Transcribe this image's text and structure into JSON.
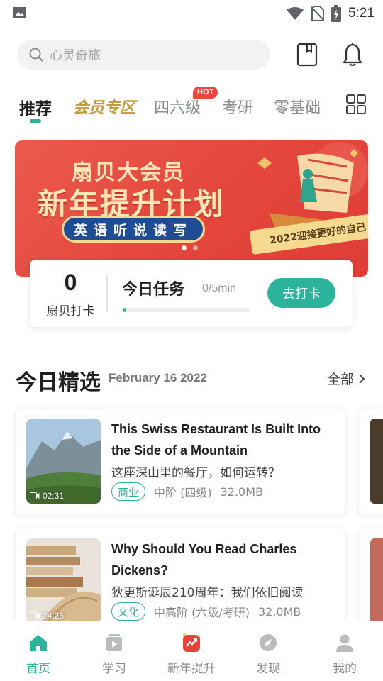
{
  "status_bar": {
    "time": "5:21"
  },
  "search": {
    "placeholder": "心灵奇旅"
  },
  "tabs": [
    {
      "label": "推荐"
    },
    {
      "label": "会员专区"
    },
    {
      "label": "四六级"
    },
    {
      "label": "考研"
    },
    {
      "label": "零基础"
    }
  ],
  "hot_badge": "HOT",
  "banner": {
    "line1": "扇贝大会员",
    "line2": "新年提升计划",
    "pill": "英语听说读写",
    "ribbon": "2022迎接更好的自己",
    "slide_count": 2,
    "active_slide": 1
  },
  "checkin": {
    "count": "0",
    "count_label": "扇贝打卡",
    "task_label": "今日任务",
    "task_progress": "0/5min",
    "progress_fraction": 0.03,
    "button": "去打卡"
  },
  "today": {
    "title": "今日精选",
    "date": "February 16 2022",
    "all_label": "全部"
  },
  "articles": [
    {
      "title": "This Swiss Restaurant Is Built Into the Side of a Mountain",
      "subtitle": "这座深山里的餐厅，如何运转？",
      "tag": "商业",
      "level": "中阶 (四级)",
      "size": "32.0MB",
      "duration": "02:31"
    },
    {
      "title": "Why Should You Read Charles Dickens?",
      "subtitle": "狄更斯诞辰210周年：我们依旧阅读",
      "tag": "文化",
      "level": "中高阶 (六级/考研)",
      "size": "32.0MB",
      "duration": "04:26"
    }
  ],
  "bottom_nav": [
    {
      "label": "首页",
      "icon": "home-icon"
    },
    {
      "label": "学习",
      "icon": "study-icon"
    },
    {
      "label": "新年提升",
      "icon": "newyear-icon"
    },
    {
      "label": "发现",
      "icon": "compass-icon"
    },
    {
      "label": "我的",
      "icon": "profile-icon"
    }
  ],
  "colors": {
    "accent": "#2bb39b",
    "banner_red": "#e4463c",
    "vip_gold": "#c79a3f",
    "hot_red": "#f0453f"
  }
}
